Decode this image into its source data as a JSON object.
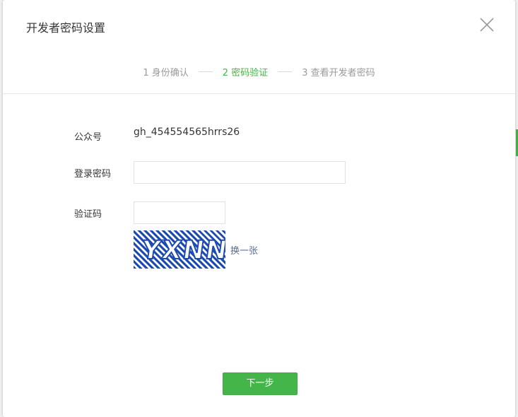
{
  "dialog": {
    "title": "开发者密码设置"
  },
  "steps": [
    {
      "label": "1 身份确认",
      "active": false
    },
    {
      "label": "2 密码验证",
      "active": true
    },
    {
      "label": "3 查看开发者密码",
      "active": false
    }
  ],
  "form": {
    "account_label": "公众号",
    "account_value": "gh_454554565hrrs26",
    "password_label": "登录密码",
    "password_value": "",
    "captcha_label": "验证码",
    "captcha_value": "",
    "captcha_image_text": "YXNN",
    "refresh_link": "换一张"
  },
  "actions": {
    "next_label": "下一步"
  },
  "colors": {
    "accent": "#44b549",
    "link": "#576b95",
    "captcha": "#1d4bb1"
  },
  "icons": {
    "close": "close-icon"
  }
}
